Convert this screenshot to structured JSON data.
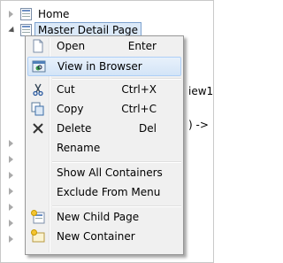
{
  "tree": {
    "home_label": "Home",
    "selected_label": "Master Detail Page"
  },
  "background_text": {
    "fragment1": "iew1",
    "fragment2": ") ->"
  },
  "menu": {
    "open_label": "Open",
    "open_shortcut": "Enter",
    "view_label": "View in Browser",
    "cut_label": "Cut",
    "cut_shortcut": "Ctrl+X",
    "copy_label": "Copy",
    "copy_shortcut": "Ctrl+C",
    "delete_label": "Delete",
    "delete_shortcut": "Del",
    "rename_label": "Rename",
    "show_containers_label": "Show All Containers",
    "exclude_label": "Exclude From Menu",
    "new_child_label": "New Child Page",
    "new_container_label": "New Container"
  }
}
